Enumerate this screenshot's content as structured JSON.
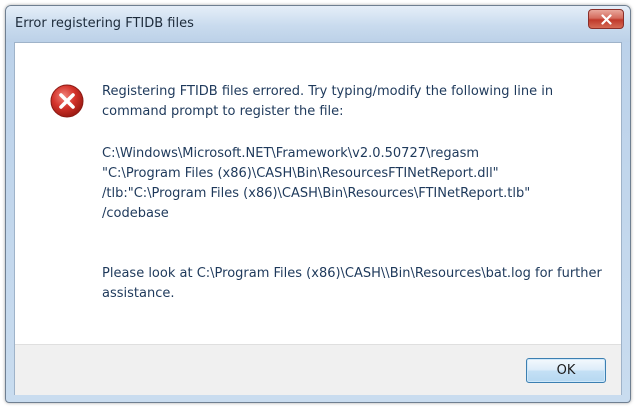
{
  "window": {
    "title": "Error registering FTIDB files"
  },
  "icons": {
    "error": "error-x-circle-icon",
    "close": "close-x-icon"
  },
  "message": {
    "line1": "Registering FTIDB files errored.  Try typing/modify the following line in command prompt to register the file:",
    "command_lines": [
      "C:\\Windows\\Microsoft.NET\\Framework\\v2.0.50727\\regasm",
      "\"C:\\Program Files (x86)\\CASH\\Bin\\ResourcesFTINetReport.dll\"",
      "/tlb:\"C:\\Program Files (x86)\\CASH\\Bin\\Resources\\FTINetReport.tlb\"",
      "/codebase"
    ],
    "line3": "Please look at C:\\Program Files (x86)\\CASH\\\\Bin\\Resources\\bat.log for further assistance."
  },
  "buttons": {
    "ok_label": "OK"
  },
  "colors": {
    "close_button": "#c0392b",
    "error_icon": "#c0221b",
    "message_text": "#1e395b"
  }
}
